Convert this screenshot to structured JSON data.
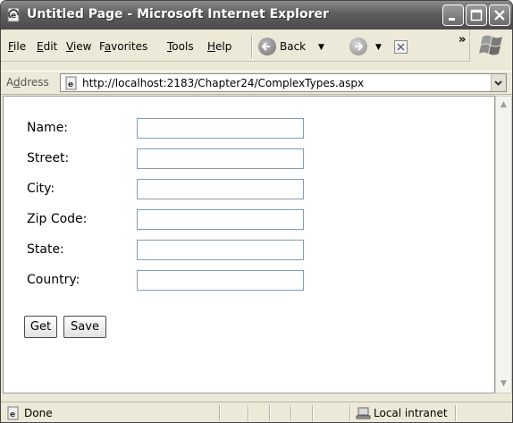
{
  "window": {
    "title": "Untitled Page - Microsoft Internet Explorer",
    "icons": {
      "app": "ie-page-icon",
      "minimize": "minimize-icon",
      "maximize": "maximize-icon",
      "close": "close-icon"
    }
  },
  "menu": {
    "items": [
      {
        "label": "File",
        "accel": "F",
        "rest": "ile"
      },
      {
        "label": "Edit",
        "accel": "E",
        "rest": "dit"
      },
      {
        "label": "View",
        "accel": "V",
        "rest": "iew"
      },
      {
        "label": "Favorites",
        "pre": "F",
        "accel": "a",
        "rest": "vorites"
      },
      {
        "label": "Tools",
        "accel": "T",
        "rest": "ools"
      },
      {
        "label": "Help",
        "accel": "H",
        "rest": "elp"
      }
    ]
  },
  "toolbar": {
    "back_label": "Back",
    "overflow": "»",
    "icons": {
      "back": "back-arrow-icon",
      "forward": "forward-arrow-icon",
      "stop": "stop-icon",
      "brand": "windows-logo-icon"
    }
  },
  "address": {
    "label": "Address",
    "label_accel": "d",
    "url": "http://localhost:2183/Chapter24/ComplexTypes.aspx"
  },
  "form": {
    "fields": [
      {
        "label": "Name:",
        "value": ""
      },
      {
        "label": "Street:",
        "value": ""
      },
      {
        "label": "City:",
        "value": ""
      },
      {
        "label": "Zip Code:",
        "value": ""
      },
      {
        "label": "State:",
        "value": ""
      },
      {
        "label": "Country:",
        "value": ""
      }
    ],
    "get_label": "Get",
    "save_label": "Save"
  },
  "status": {
    "text": "Done",
    "zone": "Local intranet"
  }
}
